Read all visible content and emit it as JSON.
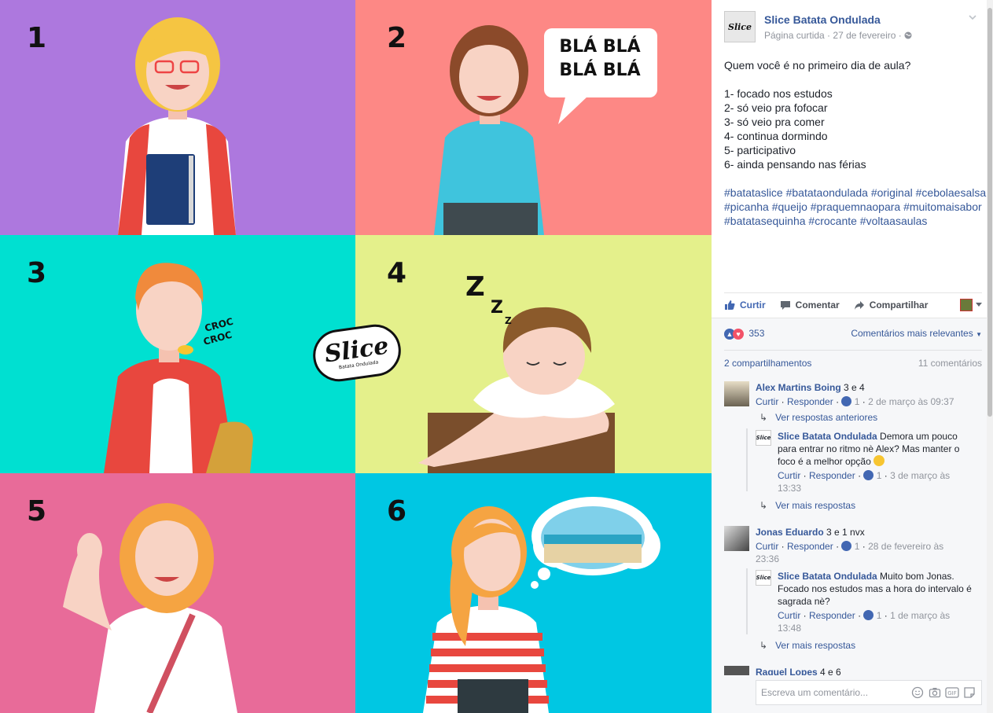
{
  "photo": {
    "panels": [
      {
        "number": "1",
        "bg": "#ad78de"
      },
      {
        "number": "2",
        "bg": "#fd8885",
        "speech": [
          "BLÁ BLÁ",
          "BLÁ BLÁ"
        ]
      },
      {
        "number": "3",
        "bg": "#00e0d1",
        "sound": [
          "CROC",
          "CROC"
        ]
      },
      {
        "number": "4",
        "bg": "#e4f08b",
        "sleep": "Z"
      },
      {
        "number": "5",
        "bg": "#e86b99"
      },
      {
        "number": "6",
        "bg": "#00c7e3"
      }
    ],
    "logo": "Slice",
    "logo_sub": "Batata Ondulada"
  },
  "post": {
    "page_name": "Slice Batata Ondulada",
    "avatar_text": "Slice",
    "meta_prefix": "Página curtida",
    "date": "27 de fevereiro",
    "lines": [
      "Quem você é no primeiro dia de aula?",
      "",
      "1- focado nos estudos",
      "2- só veio pra fofocar",
      "3- só veio pra comer",
      "4- continua dormindo",
      "5- participativo",
      "6- ainda pensando nas férias",
      ""
    ],
    "hashtags": "#batataslice #batataondulada #original #cebolaesalsa #picanha #queijo #praquemnaopara #muitomaisabor #batatasequinha #crocante #voltaasaulas"
  },
  "actions": {
    "like": "Curtir",
    "comment": "Comentar",
    "share": "Compartilhar"
  },
  "feedback": {
    "reactions_count": "353",
    "sort_label": "Comentários mais relevantes",
    "shares": "2 compartilhamentos",
    "comments_count": "11 comentários"
  },
  "comments": [
    {
      "name": "Alex Martins Boing",
      "text": "3 e 4",
      "like_label": "Curtir",
      "reply_label": "Responder",
      "likes": "1",
      "time": "2 de março às 09:37",
      "prev_replies": "Ver respostas anteriores",
      "reply": {
        "name": "Slice Batata Ondulada",
        "text": "Demora um pouco para entrar no ritmo nè Alex? Mas manter o foco é a melhor opção",
        "like_label": "Curtir",
        "reply_label": "Responder",
        "likes": "1",
        "time": "3 de março às 13:33"
      },
      "more_replies": "Ver mais respostas"
    },
    {
      "name": "Jonas Eduardo",
      "text": "3 e 1 nvx",
      "like_label": "Curtir",
      "reply_label": "Responder",
      "likes": "1",
      "time": "28 de fevereiro às 23:36",
      "reply": {
        "name": "Slice Batata Ondulada",
        "text": "Muito bom Jonas. Focado nos estudos mas a hora do intervalo é sagrada nè?",
        "like_label": "Curtir",
        "reply_label": "Responder",
        "likes": "1",
        "time": "1 de março às 13:48"
      },
      "more_replies": "Ver mais respostas"
    },
    {
      "name": "Raquel Lopes",
      "text": "4 e 6"
    }
  ],
  "composer": {
    "placeholder": "Escreva um comentário..."
  },
  "colors": {
    "link": "#365899",
    "like_blue": "#4267b2",
    "love_red": "#f25268"
  }
}
